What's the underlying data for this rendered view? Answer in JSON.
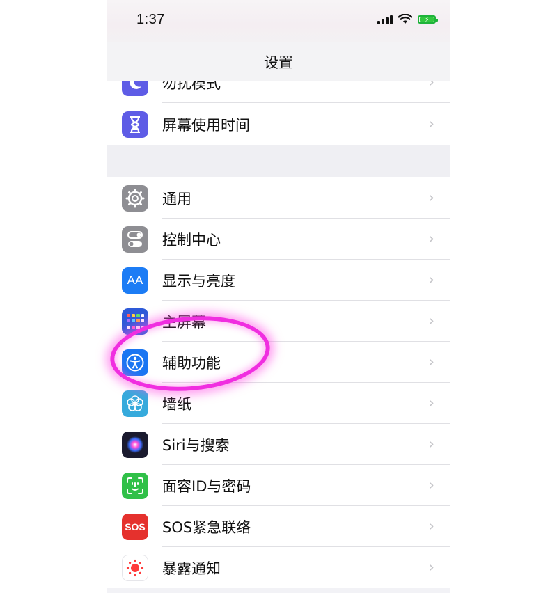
{
  "status_bar": {
    "time": "1:37"
  },
  "nav": {
    "title": "设置"
  },
  "group1": [
    {
      "label": "勿扰模式",
      "icon": "moon-icon",
      "color": "#5e5ce6"
    },
    {
      "label": "屏幕使用时间",
      "icon": "hourglass-icon",
      "color": "#5e5ce6"
    }
  ],
  "group2": [
    {
      "label": "通用",
      "icon": "gear-icon",
      "color": "#8e8e93"
    },
    {
      "label": "控制中心",
      "icon": "toggles-icon",
      "color": "#8e8e93"
    },
    {
      "label": "显示与亮度",
      "icon": "text-size-icon",
      "icon_text": "AA",
      "color": "#1c7cf5"
    },
    {
      "label": "主屏幕",
      "icon": "home-grid-icon",
      "color": "#2e5ad8"
    },
    {
      "label": "辅助功能",
      "icon": "accessibility-icon",
      "color": "#1b76f2"
    },
    {
      "label": "墙纸",
      "icon": "flower-icon",
      "color": "#36aadc"
    },
    {
      "label": "Siri与搜索",
      "icon": "siri-icon",
      "color": "#1a1a2e"
    },
    {
      "label": "面容ID与密码",
      "icon": "face-id-icon",
      "color": "#30c048"
    },
    {
      "label": "SOS紧急联络",
      "icon": "sos-icon",
      "icon_text": "SOS",
      "color": "#e5312d"
    },
    {
      "label": "暴露通知",
      "icon": "exposure-icon",
      "color": "#ffffff"
    }
  ],
  "chevron": "›",
  "annotation_color": "#f02ee0"
}
